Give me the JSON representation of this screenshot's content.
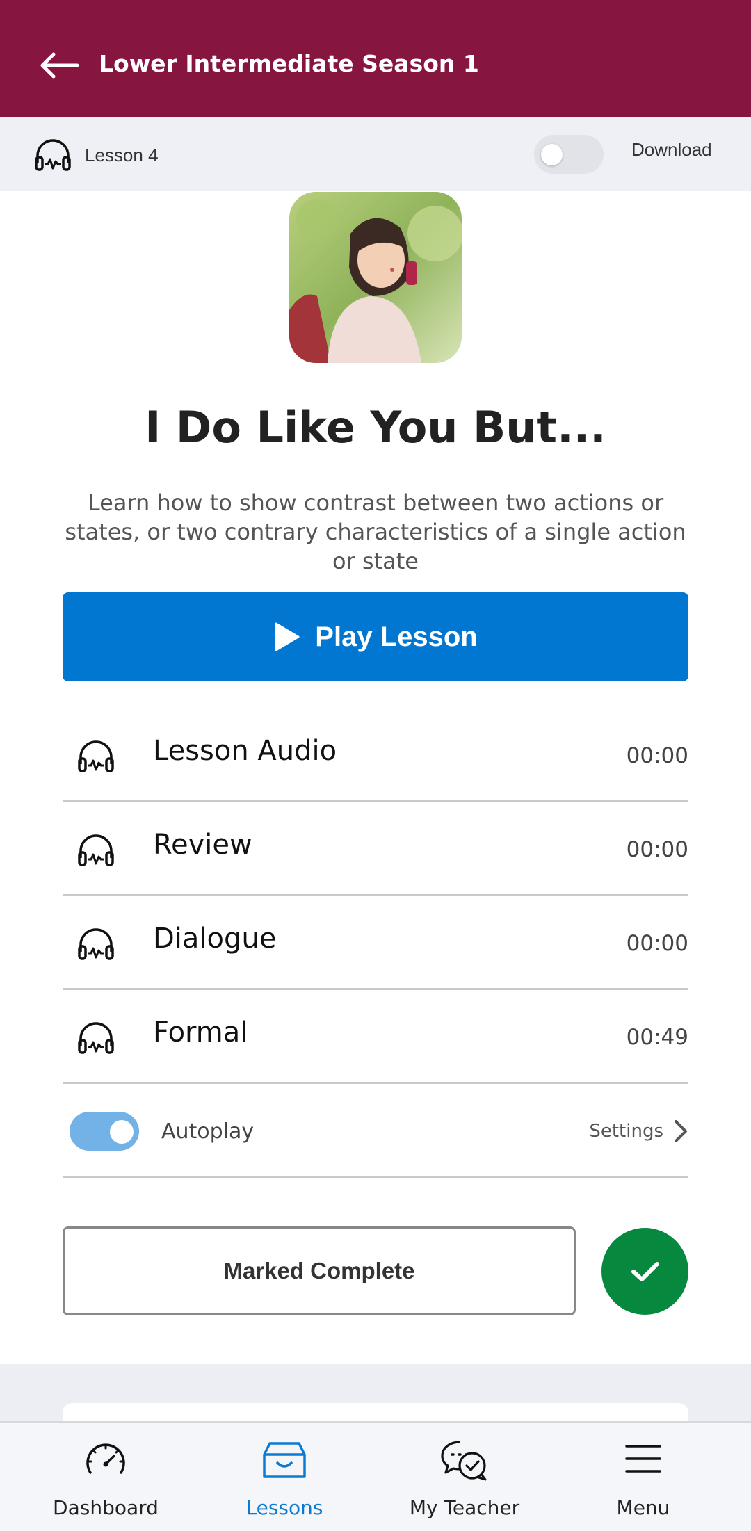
{
  "header": {
    "title": "Lower Intermediate Season 1",
    "bg_color": "#861640"
  },
  "subbar": {
    "lesson_number": "Lesson 4",
    "download_label": "Download",
    "download_enabled": false
  },
  "lesson": {
    "title": "I Do Like You But...",
    "description": "Learn how to show contrast between two actions or states, or two contrary characteristics of a single action or state",
    "play_label": "Play Lesson"
  },
  "tracks": [
    {
      "name": "Lesson Audio",
      "time": "00:00"
    },
    {
      "name": "Review",
      "time": "00:00"
    },
    {
      "name": "Dialogue",
      "time": "00:00"
    },
    {
      "name": "Formal",
      "time": "00:49"
    }
  ],
  "autoplay": {
    "label": "Autoplay",
    "enabled": true,
    "settings_label": "Settings"
  },
  "completion": {
    "label": "Marked Complete",
    "completed": true,
    "accent": "#07883f"
  },
  "bottom_nav": {
    "items": [
      {
        "label": "Dashboard",
        "icon": "speedometer-icon",
        "active": false
      },
      {
        "label": "Lessons",
        "icon": "inbox-icon",
        "active": true
      },
      {
        "label": "My Teacher",
        "icon": "chat-check-icon",
        "active": false
      },
      {
        "label": "Menu",
        "icon": "hamburger-icon",
        "active": false
      }
    ],
    "active_color": "#0b7bd1"
  },
  "colors": {
    "primary_button": "#0277d1",
    "toggle_on": "#73b2e6"
  }
}
